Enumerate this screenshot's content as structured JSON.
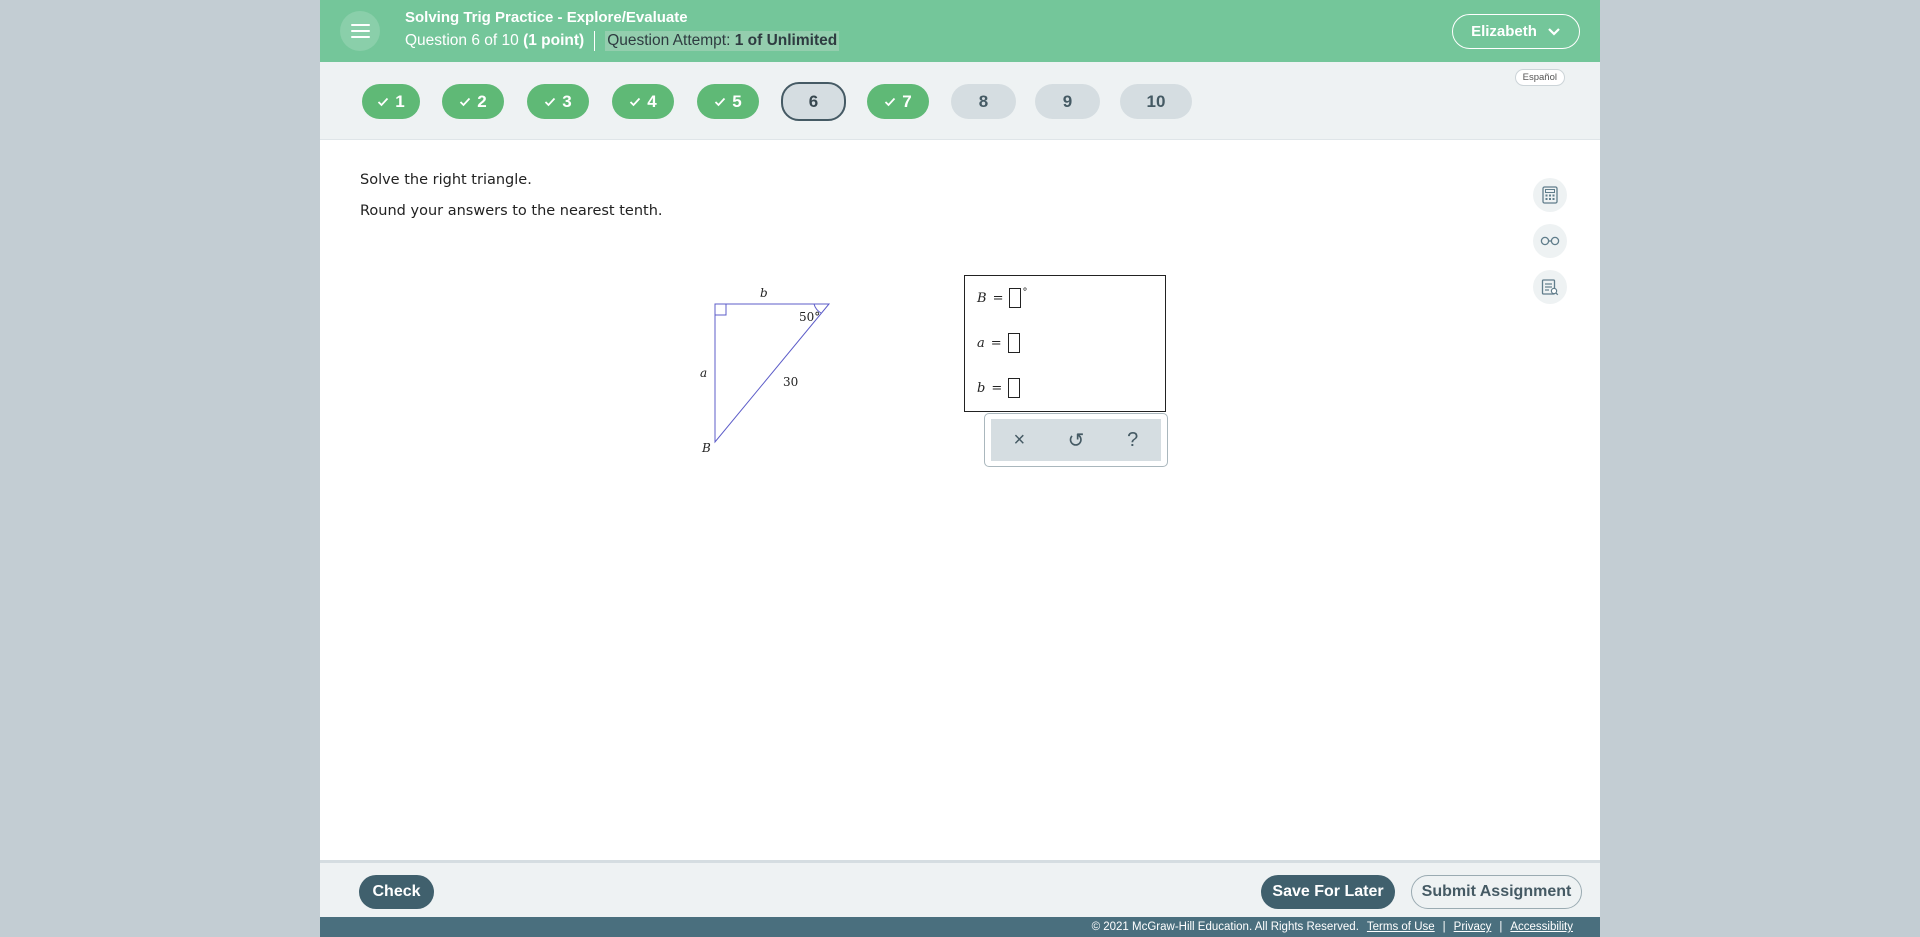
{
  "header": {
    "assignment_title": "Solving Trig Practice - Explore/Evaluate",
    "question_label": "Question 6 of 10",
    "points_label": "(1 point)",
    "attempt_label": "Question Attempt:",
    "attempt_value": "1 of Unlimited",
    "user_name": "Elizabeth"
  },
  "nav": {
    "language_link": "Español",
    "questions": [
      {
        "label": "1",
        "status": "done"
      },
      {
        "label": "2",
        "status": "done"
      },
      {
        "label": "3",
        "status": "done"
      },
      {
        "label": "4",
        "status": "done"
      },
      {
        "label": "5",
        "status": "done"
      },
      {
        "label": "6",
        "status": "current"
      },
      {
        "label": "7",
        "status": "done"
      },
      {
        "label": "8",
        "status": "todo"
      },
      {
        "label": "9",
        "status": "todo"
      },
      {
        "label": "10",
        "status": "todo"
      }
    ]
  },
  "content": {
    "instruction_1": "Solve the right triangle.",
    "instruction_2": "Round your answers to the nearest tenth.",
    "triangle": {
      "side_top": "b",
      "side_left": "a",
      "hypotenuse": "30",
      "angle": "50°",
      "vertex": "B"
    },
    "answers": [
      {
        "var": "B",
        "eq": "=",
        "unit": "°"
      },
      {
        "var": "a",
        "eq": "=",
        "unit": ""
      },
      {
        "var": "b",
        "eq": "=",
        "unit": ""
      }
    ],
    "toolbar": {
      "clear_symbol": "×",
      "undo_symbol": "↺",
      "help_symbol": "?"
    }
  },
  "tools": [
    "calculator-icon",
    "glasses-icon",
    "reference-sheet-icon"
  ],
  "footer": {
    "check_label": "Check",
    "save_label": "Save For Later",
    "submit_label": "Submit Assignment",
    "copyright": "© 2021 McGraw-Hill Education. All Rights Reserved.",
    "terms": "Terms of Use",
    "privacy": "Privacy",
    "accessibility": "Accessibility",
    "separator": "|"
  },
  "colors": {
    "header_green": "#74c69a",
    "done_green": "#5fb976",
    "dark_slate": "#40606d"
  }
}
